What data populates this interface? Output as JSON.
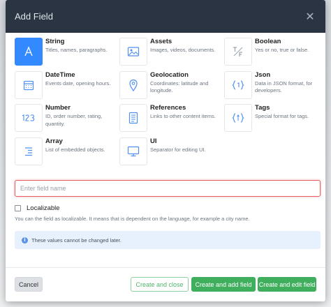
{
  "modal": {
    "title": "Add Field",
    "close_symbol": "✕"
  },
  "field_types": [
    {
      "name": "String",
      "desc": "Titles, names, paragraphs.",
      "icon": "text-a-icon",
      "selected": true
    },
    {
      "name": "Assets",
      "desc": "Images, videos, documents.",
      "icon": "image-icon",
      "selected": false
    },
    {
      "name": "Boolean",
      "desc": "Yes or no, true or false.",
      "icon": "toggle-tf-icon",
      "selected": false
    },
    {
      "name": "DateTime",
      "desc": "Events date, opening hours.",
      "icon": "calendar-icon",
      "selected": false
    },
    {
      "name": "Geolocation",
      "desc": "Coordinates: latitude and longitude.",
      "icon": "map-pin-icon",
      "selected": false
    },
    {
      "name": "Json",
      "desc": "Data in JSON format, for developers.",
      "icon": "json-braces-icon",
      "selected": false
    },
    {
      "name": "Number",
      "desc": "ID, order number, rating, quantity.",
      "icon": "number-123-icon",
      "selected": false
    },
    {
      "name": "References",
      "desc": "Links to other content items.",
      "icon": "document-icon",
      "selected": false
    },
    {
      "name": "Tags",
      "desc": "Special format for tags.",
      "icon": "tags-icon",
      "selected": false
    },
    {
      "name": "Array",
      "desc": "List of embedded objects.",
      "icon": "list-icon",
      "selected": false
    },
    {
      "name": "UI",
      "desc": "Separator for editing UI.",
      "icon": "monitor-icon",
      "selected": false
    }
  ],
  "field_name_input": {
    "value": "",
    "placeholder": "Enter field name"
  },
  "localizable": {
    "label": "Localizable",
    "checked": false,
    "hint": "You can the field as localizable. It means that is dependent on the language, for example a city name."
  },
  "info": {
    "icon_symbol": "i",
    "text": "These values cannot be changed later."
  },
  "buttons": {
    "cancel": "Cancel",
    "create_close": "Create and close",
    "create_add": "Create and add field",
    "create_edit": "Create and edit field"
  },
  "colors": {
    "header_bg": "#2a3442",
    "selected_accent": "#3389ff",
    "icon_color": "#4f8ff2",
    "error_border": "#e35d5d",
    "success": "#3fae5d"
  }
}
